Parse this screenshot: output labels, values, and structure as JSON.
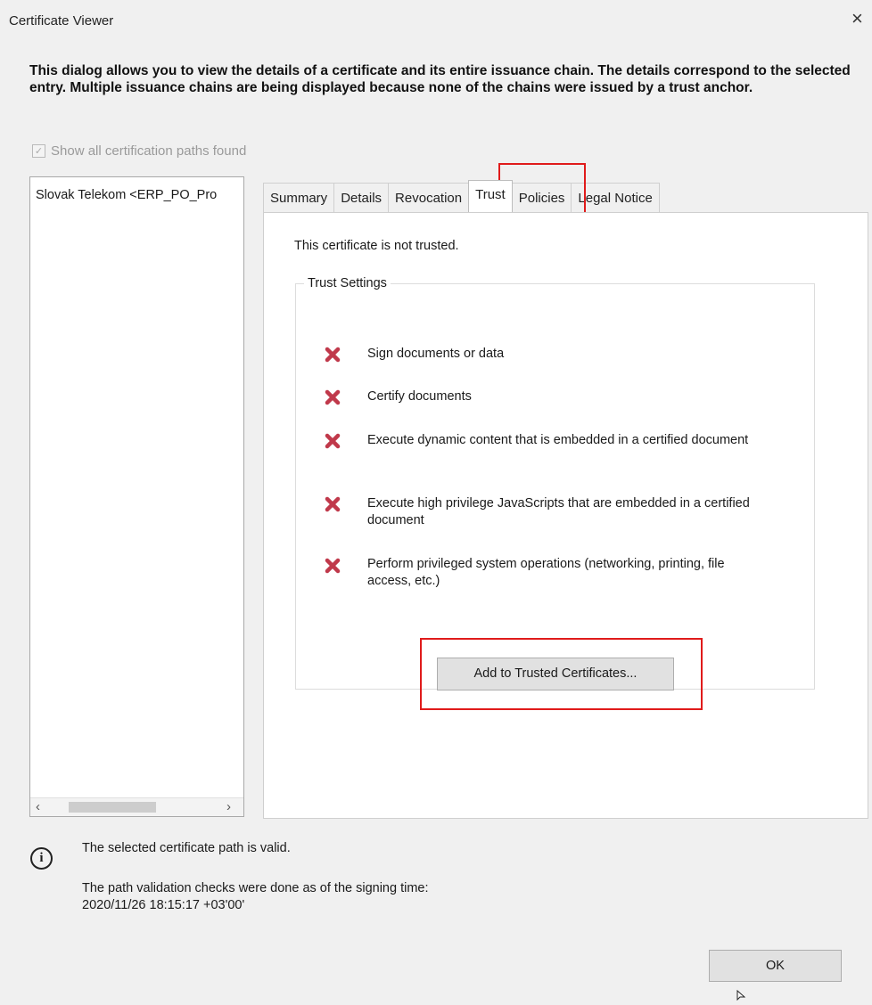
{
  "window": {
    "title": "Certificate Viewer",
    "close_glyph": "×"
  },
  "intro": "This dialog allows you to view the details of a certificate and its entire issuance chain. The details correspond to the selected entry. Multiple issuance chains are being displayed because none of the chains were issued by a trust anchor.",
  "show_all": {
    "label": "Show all certification paths found",
    "checked": true,
    "enabled": false
  },
  "tree": {
    "items": [
      "Slovak Telekom <ERP_PO_Pro"
    ]
  },
  "tabs": [
    {
      "label": "Summary",
      "active": false
    },
    {
      "label": "Details",
      "active": false
    },
    {
      "label": "Revocation",
      "active": false
    },
    {
      "label": "Trust",
      "active": true
    },
    {
      "label": "Policies",
      "active": false
    },
    {
      "label": "Legal Notice",
      "active": false
    }
  ],
  "trust": {
    "status": "This certificate is not trusted.",
    "group_title": "Trust Settings",
    "permissions": [
      {
        "icon": "red-x-icon",
        "text": "Sign documents or data"
      },
      {
        "icon": "red-x-icon",
        "text": "Certify documents"
      },
      {
        "icon": "red-x-icon",
        "text": "Execute dynamic content that is embedded in a certified document"
      },
      {
        "icon": "red-x-icon",
        "text": "Execute high privilege JavaScripts that are embedded in a certified document"
      },
      {
        "icon": "red-x-icon",
        "text": "Perform privileged system operations (networking, printing, file access, etc.)"
      }
    ],
    "add_button": "Add to Trusted Certificates..."
  },
  "footer": {
    "icon": "info-icon",
    "status": "The selected certificate path is valid.",
    "validation_line1": "The path validation checks were done as of the signing time:",
    "validation_line2": "2020/11/26 18:15:17 +03'00'",
    "ok_button": "OK"
  },
  "colors": {
    "highlight": "#e01b1b",
    "x_icon": "#c0394b",
    "background": "#f0f0f0"
  }
}
